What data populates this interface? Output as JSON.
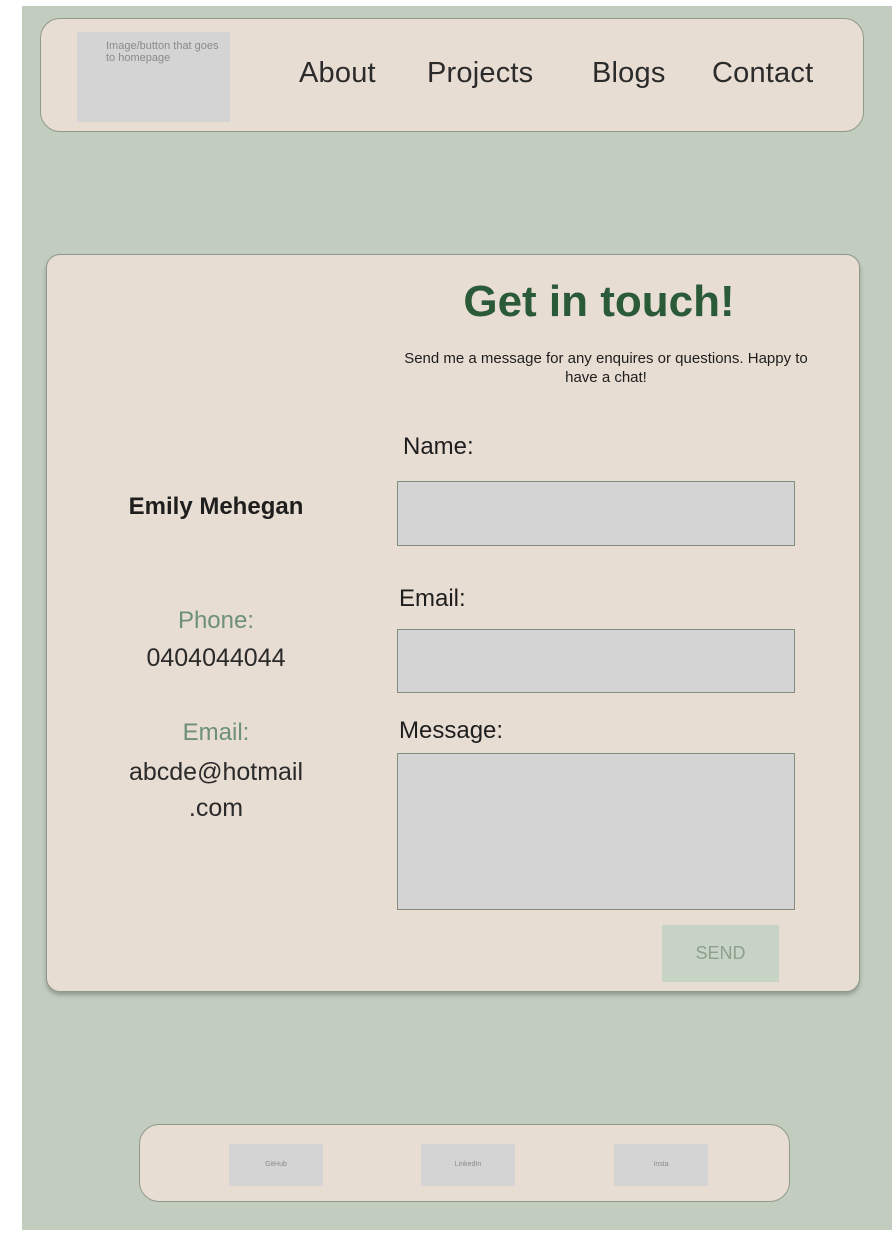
{
  "nav": {
    "home_button_text": "Image/button that goes to homepage",
    "links": [
      "About",
      "Projects",
      "Blogs",
      "Contact"
    ]
  },
  "contact_card": {
    "title": "Get in touch!",
    "subtitle": "Send me a message for any enquires or questions. Happy to have a chat!",
    "name": "Emily Mehegan",
    "phone_label": "Phone:",
    "phone_value": "0404044044",
    "email_label": "Email:",
    "email_value_line1": "abcde@hotmail",
    "email_value_line2": ".com"
  },
  "form": {
    "name_label": "Name:",
    "email_label": "Email:",
    "message_label": "Message:",
    "send_label": "SEND"
  },
  "footer": {
    "links": [
      "GitHub",
      "LinkedIn",
      "Insta"
    ]
  }
}
